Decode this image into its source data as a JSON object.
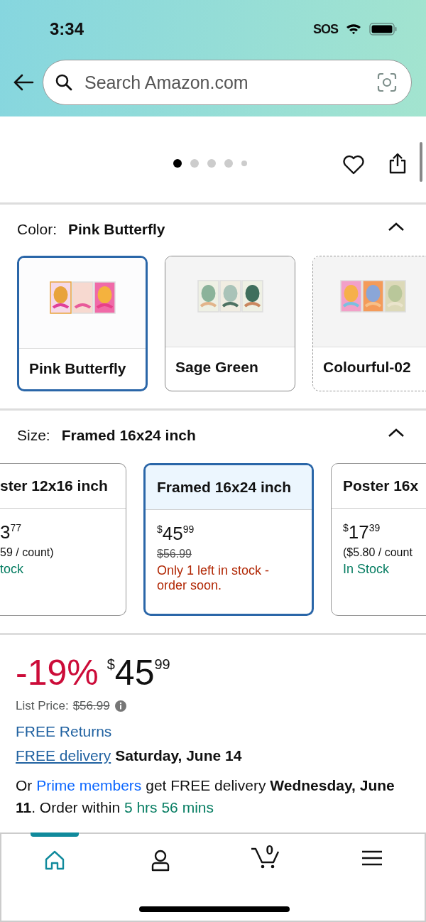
{
  "status_bar": {
    "time": "3:34",
    "sos": "SOS"
  },
  "search": {
    "placeholder": "Search Amazon.com"
  },
  "image_dots": [
    {
      "selected": true,
      "small": false
    },
    {
      "selected": false,
      "small": false
    },
    {
      "selected": false,
      "small": false
    },
    {
      "selected": false,
      "small": false
    },
    {
      "selected": false,
      "small": true
    }
  ],
  "color": {
    "label": "Color:",
    "value": "Pink Butterfly",
    "expanded": true,
    "options": [
      {
        "name": "Pink Butterfly",
        "selected": true,
        "available": true,
        "kind": "pink"
      },
      {
        "name": "Sage Green",
        "selected": false,
        "available": true,
        "kind": "sage"
      },
      {
        "name": "Colourful-02",
        "selected": false,
        "available": false,
        "kind": "swirl"
      }
    ]
  },
  "size": {
    "label": "Size:",
    "value": "Framed 16x24 inch",
    "expanded": true,
    "options": [
      {
        "name": "ster 12x16 inch",
        "selected": false,
        "whole": "3",
        "fraction": "77",
        "unit": "59 / count)",
        "stock": "tock",
        "color": "#067d62"
      },
      {
        "name": "Framed 16x24 inch",
        "selected": true,
        "currency": "$",
        "whole": "45",
        "fraction": "99",
        "was": "$56.99",
        "stock": "Only 1 left in stock - order soon.",
        "color": "#b12704"
      },
      {
        "name": "Poster 16x",
        "selected": false,
        "currency": "$",
        "whole": "17",
        "fraction": "39",
        "unit": "($5.80 / count",
        "stock": "In Stock",
        "color": "#067d62"
      }
    ]
  },
  "price": {
    "discount": "-19%",
    "currency": "$",
    "whole": "45",
    "fraction": "99",
    "list_label": "List Price:",
    "list_price": "$56.99"
  },
  "returns": "FREE Returns",
  "delivery": {
    "link": "FREE delivery",
    "date": "Saturday, June 14"
  },
  "prime": {
    "prefix": "Or",
    "link": "Prime members",
    "middle": "get FREE delivery **Wednesday, June 11**. Order within",
    "countdown": "5 hrs 56 mins"
  },
  "nav": [
    {
      "kind": "home",
      "selected": true
    },
    {
      "kind": "account",
      "selected": false
    },
    {
      "kind": "cart",
      "selected": false,
      "count": "0"
    },
    {
      "kind": "menu",
      "selected": false
    }
  ]
}
